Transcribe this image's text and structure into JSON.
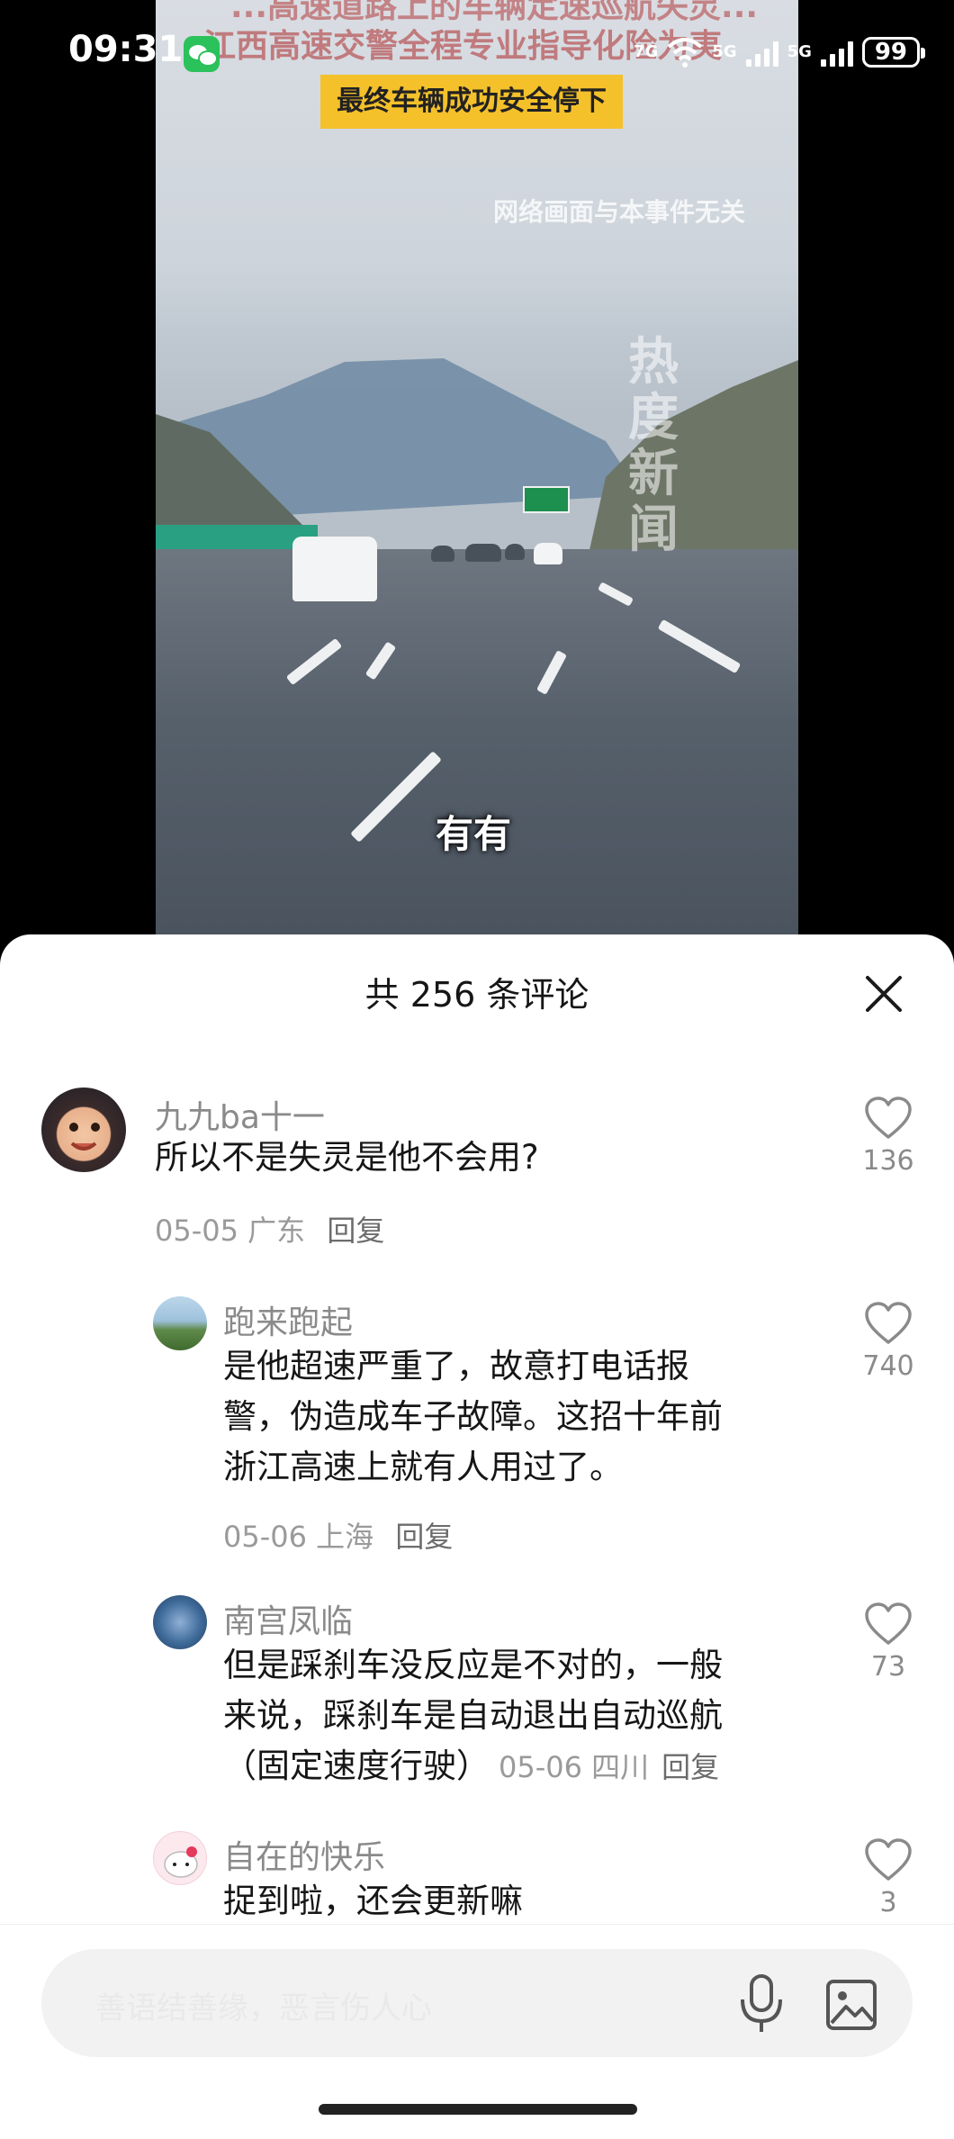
{
  "status_bar": {
    "time": "09:31",
    "network_label_1": "7G",
    "network_label_2": "5G",
    "network_label_3": "5G",
    "battery": "99",
    "icons": [
      "wechat-icon",
      "wifi-icon",
      "signal-icon",
      "battery-icon"
    ]
  },
  "video": {
    "top_caption_line1": "...高速道路上的车辆定速巡航失灵...",
    "top_caption_line2": "江西高速交警全程专业指导化险为夷",
    "banner": "最终车辆成功安全停下",
    "disclaimer": "网络画面与本事件无关",
    "watermark": "热度新闻",
    "subtitle": "有有"
  },
  "comments_panel": {
    "title": "共 256 条评论",
    "comments": [
      {
        "user": "九九ba十一",
        "text": "所以不是失灵是他不会用?",
        "date": "05-05",
        "location": "广东",
        "reply_label": "回复",
        "likes": "136"
      },
      {
        "user": "跑来跑起",
        "text_lines": [
          "是他超速严重了，故意打电话报",
          "警，伪造成车子故障。这招十年前",
          "浙江高速上就有人用过了。"
        ],
        "date": "05-06",
        "location": "上海",
        "reply_label": "回复",
        "likes": "740"
      },
      {
        "user": "南宫凤临",
        "text_lines": [
          "但是踩刹车没反应是不对的，一般",
          "来说，踩刹车是自动退出自动巡航",
          "（固定速度行驶）"
        ],
        "date": "05-06",
        "location": "四川",
        "reply_label": "回复",
        "likes": "73"
      },
      {
        "user": "自在的快乐",
        "text": "捉到啦，还会更新嘛",
        "likes": "3"
      }
    ]
  },
  "input_bar": {
    "placeholder": "善语结善缘，恶言伤人心",
    "icons": [
      "mic-icon",
      "image-icon"
    ]
  },
  "colors": {
    "banner_yellow": "#f4c12b",
    "sheet_bg": "#ffffff",
    "muted_text": "#8a8a8a"
  }
}
